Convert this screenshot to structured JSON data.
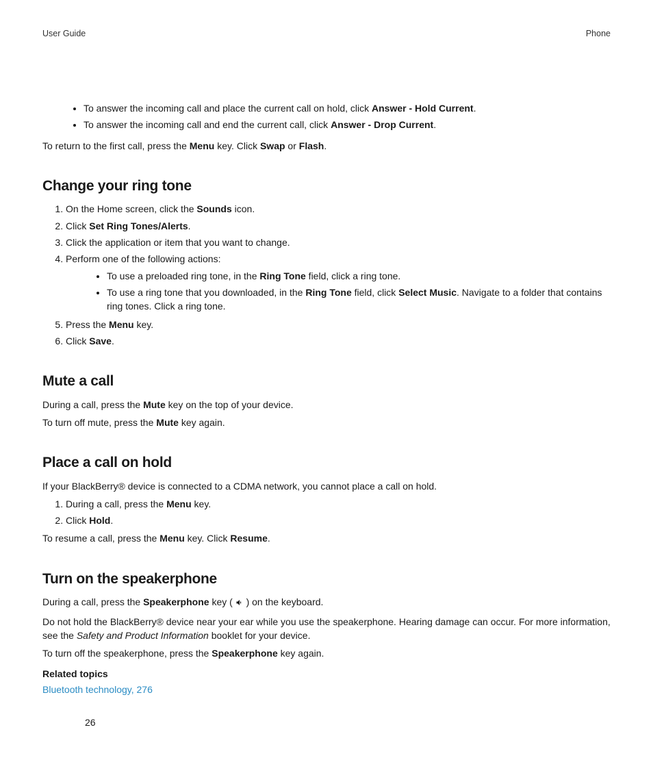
{
  "header": {
    "left": "User Guide",
    "right": "Phone"
  },
  "intro": {
    "b1a": "To answer the incoming call and place the current call on hold, click ",
    "b1b": "Answer - Hold Current",
    "b1c": ".",
    "b2a": "To answer the incoming call and end the current call, click ",
    "b2b": "Answer - Drop Current",
    "b2c": ".",
    "ret1": "To return to the first call, press the ",
    "ret2": "Menu",
    "ret3": " key. Click ",
    "ret4": "Swap",
    "ret5": " or ",
    "ret6": "Flash",
    "ret7": "."
  },
  "s1": {
    "title": "Change your ring tone",
    "i1a": "On the Home screen, click the ",
    "i1b": "Sounds",
    "i1c": " icon.",
    "i2a": "Click ",
    "i2b": "Set Ring Tones/Alerts",
    "i2c": ".",
    "i3": "Click the application or item that you want to change.",
    "i4": "Perform one of the following actions:",
    "i4b1a": "To use a preloaded ring tone, in the ",
    "i4b1b": "Ring Tone",
    "i4b1c": " field, click a ring tone.",
    "i4b2a": "To use a ring tone that you downloaded, in the ",
    "i4b2b": "Ring Tone",
    "i4b2c": " field, click ",
    "i4b2d": "Select Music",
    "i4b2e": ". Navigate to a folder that contains ring tones. Click a ring tone.",
    "i5a": "Press the ",
    "i5b": "Menu",
    "i5c": " key.",
    "i6a": "Click ",
    "i6b": "Save",
    "i6c": "."
  },
  "s2": {
    "title": "Mute a call",
    "p1a": "During a call, press the ",
    "p1b": "Mute",
    "p1c": " key on the top of your device.",
    "p2a": "To turn off mute, press the ",
    "p2b": "Mute",
    "p2c": " key again."
  },
  "s3": {
    "title": "Place a call on hold",
    "p1": "If your BlackBerry® device is connected to a CDMA network, you cannot place a call on hold.",
    "i1a": "During a call, press the ",
    "i1b": "Menu",
    "i1c": " key.",
    "i2a": "Click ",
    "i2b": "Hold",
    "i2c": ".",
    "p2a": "To resume a call, press the ",
    "p2b": "Menu",
    "p2c": " key. Click ",
    "p2d": "Resume",
    "p2e": "."
  },
  "s4": {
    "title": "Turn on the speakerphone",
    "p1a": "During a call, press the ",
    "p1b": "Speakerphone",
    "p1c": " key ( ",
    "p1d": " ) on the keyboard.",
    "p2a": "Do not hold the BlackBerry® device near your ear while you use the speakerphone. Hearing damage can occur. For more information, see the ",
    "p2b": "Safety and Product Information",
    "p2c": " booklet for your device.",
    "p3a": "To turn off the speakerphone, press the ",
    "p3b": "Speakerphone",
    "p3c": " key again.",
    "rel": "Related topics",
    "link": "Bluetooth technology, 276"
  },
  "page": "26"
}
